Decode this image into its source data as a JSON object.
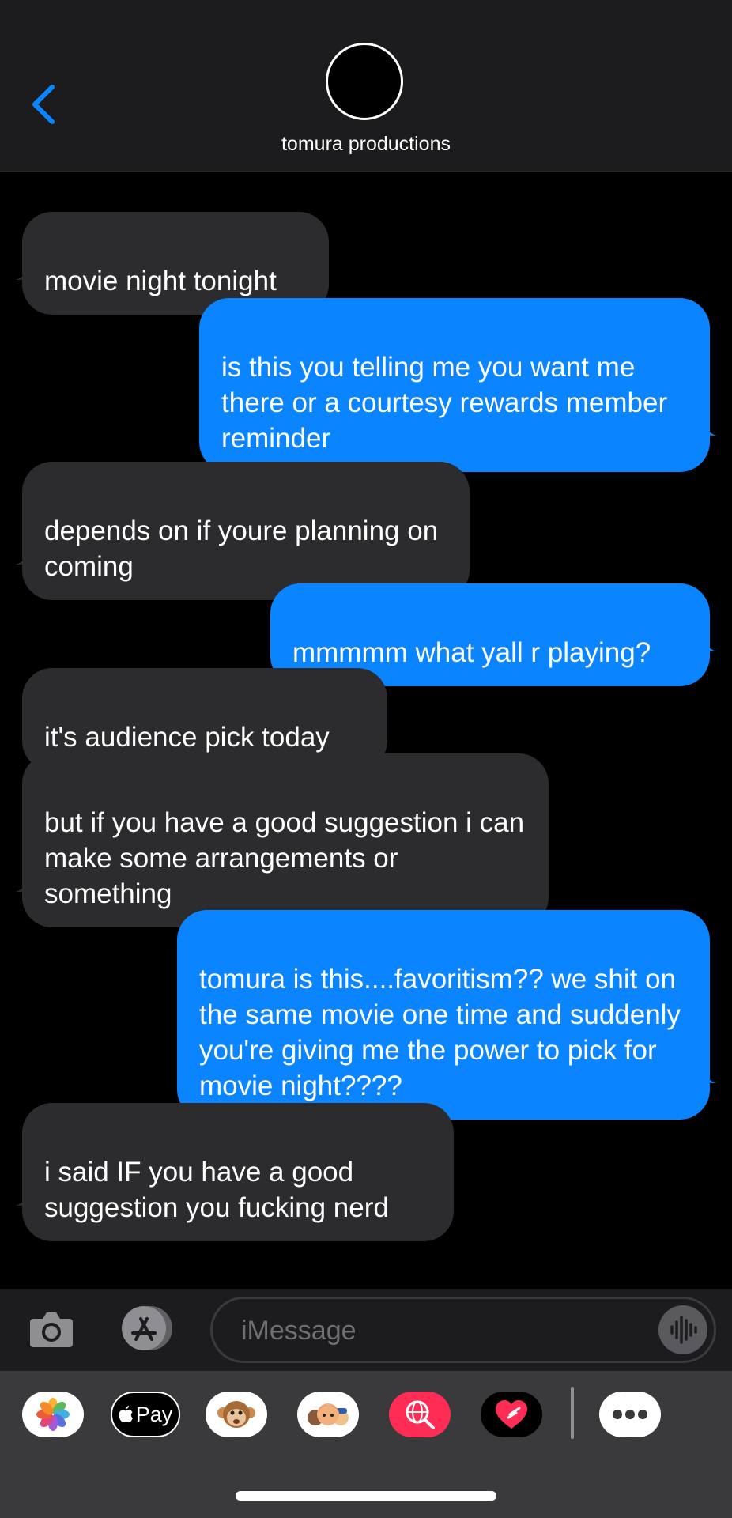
{
  "header": {
    "contact_name": "tomura productions",
    "back_icon": "chevron-left-icon",
    "accent_color": "#0a84ff"
  },
  "messages": [
    {
      "direction": "received",
      "text": "movie night tonight"
    },
    {
      "direction": "sent",
      "text": "is this you telling me you want me there or a courtesy rewards member reminder"
    },
    {
      "direction": "received",
      "text": "depends on if youre planning on coming"
    },
    {
      "direction": "sent",
      "text": "mmmmm what yall r playing?"
    },
    {
      "direction": "received",
      "text": "it's audience pick today"
    },
    {
      "direction": "received",
      "text": "but if you have a good suggestion i can make some arrangements or something"
    },
    {
      "direction": "sent",
      "text": "tomura is this....favoritism?? we shit on the same movie one time and suddenly you're giving me the power to pick for movie night????"
    },
    {
      "direction": "received",
      "text": "i said IF you have a good suggestion you fucking nerd"
    }
  ],
  "composer": {
    "placeholder": "iMessage",
    "value": "",
    "icons": [
      "camera-icon",
      "app-store-icon",
      "audio-waveform-icon"
    ]
  },
  "app_drawer": {
    "apps": [
      {
        "name": "photos",
        "icon": "photos-icon"
      },
      {
        "name": "apple-pay",
        "icon": "apple-pay-icon",
        "label": "Pay"
      },
      {
        "name": "animoji",
        "icon": "monkey-icon"
      },
      {
        "name": "memoji",
        "icon": "memoji-icon"
      },
      {
        "name": "images-search",
        "icon": "globe-search-icon"
      },
      {
        "name": "digital-touch",
        "icon": "heart-icon"
      },
      {
        "name": "more",
        "icon": "more-icon"
      }
    ]
  },
  "colors": {
    "received_bubble": "#2c2c2e",
    "sent_bubble": "#0a84ff",
    "background": "#000000"
  }
}
